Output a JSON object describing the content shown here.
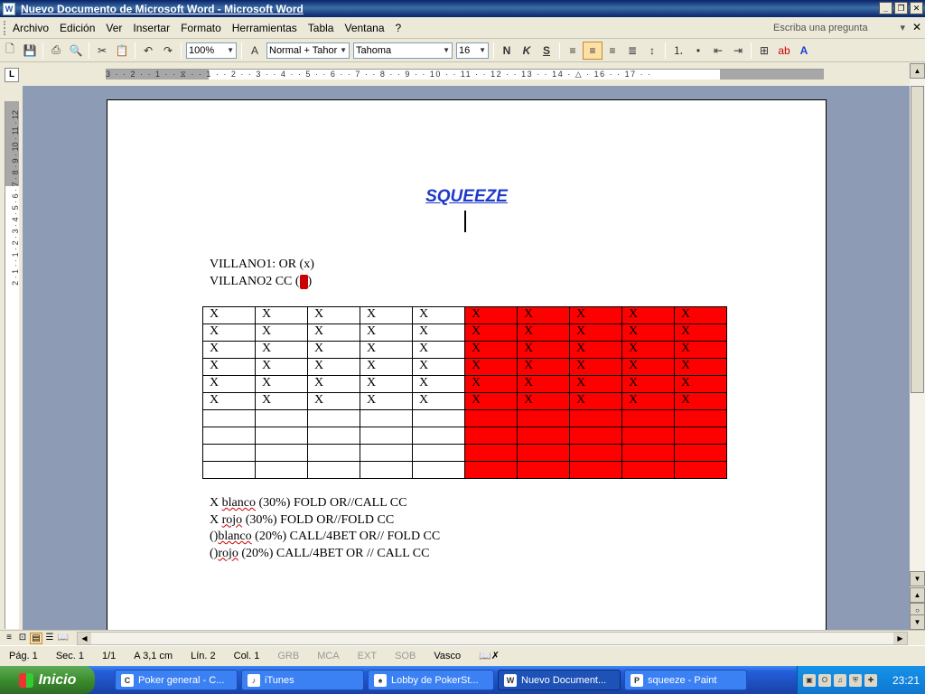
{
  "window": {
    "title": "Nuevo Documento de Microsoft Word - Microsoft Word",
    "app_icon": "W"
  },
  "menu": {
    "items": [
      "Archivo",
      "Edición",
      "Ver",
      "Insertar",
      "Formato",
      "Herramientas",
      "Tabla",
      "Ventana",
      "?"
    ],
    "help_placeholder": "Escriba una pregunta"
  },
  "toolbar": {
    "zoom": "100%",
    "style": "Normal + Tahor",
    "font": "Tahoma",
    "size": "16"
  },
  "ruler": {
    "scale": "3 · · 2 · · 1 · · ⧖ · · 1 · · 2 · · 3 · · 4 · · 5 · · 6 · · 7 · · 8 · · 9 · · 10 · · 11 · · 12 · · 13 · · 14 · △ · 16 · · 17 · ·",
    "vscale": "2 · 1 · · 1 · 2 · 3 · 4 · 5 · 6 · 7 · 8 · 9 · 10 · 11 · 12",
    "tab_selector": "L"
  },
  "document": {
    "heading": "SQUEEZE",
    "villano1": "VILLANO1: OR  (x)",
    "villano2": "VILLANO2 CC  (",
    "villano2_end": ")",
    "grid": {
      "rows": [
        [
          "X",
          "X",
          "X",
          "X",
          "X",
          "X",
          "X",
          "X",
          "X",
          "X"
        ],
        [
          "X",
          "X",
          "X",
          "X",
          "X",
          "X",
          "X",
          "X",
          "X",
          "X"
        ],
        [
          "X",
          "X",
          "X",
          "X",
          "X",
          "X",
          "X",
          "X",
          "X",
          "X"
        ],
        [
          "X",
          "X",
          "X",
          "X",
          "X",
          "X",
          "X",
          "X",
          "X",
          "X"
        ],
        [
          "X",
          "X",
          "X",
          "X",
          "X",
          "X",
          "X",
          "X",
          "X",
          "X"
        ],
        [
          "X",
          "X",
          "X",
          "X",
          "X",
          "X",
          "X",
          "X",
          "X",
          "X"
        ],
        [
          "",
          "",
          "",
          "",
          "",
          "",
          "",
          "",
          "",
          ""
        ],
        [
          "",
          "",
          "",
          "",
          "",
          "",
          "",
          "",
          "",
          ""
        ],
        [
          "",
          "",
          "",
          "",
          "",
          "",
          "",
          "",
          "",
          ""
        ],
        [
          "",
          "",
          "",
          "",
          "",
          "",
          "",
          "",
          "",
          ""
        ]
      ],
      "red_color": "#ff0000"
    },
    "legend": [
      {
        "prefix": "X ",
        "word": "blanco",
        "suffix": " (30%) FOLD OR//CALL CC"
      },
      {
        "prefix": "X ",
        "word": "rojo",
        "suffix": " (30%) FOLD OR//FOLD CC"
      },
      {
        "prefix": "()",
        "word": "blanco",
        "suffix": " (20%) CALL/4BET OR// FOLD CC"
      },
      {
        "prefix": "()",
        "word": "rojo",
        "suffix": " (20%) CALL/4BET OR // CALL CC"
      }
    ]
  },
  "status": {
    "page": "Pág. 1",
    "section": "Sec. 1",
    "pages": "1/1",
    "position": "A  3,1 cm",
    "line": "Lín. 2",
    "column": "Col. 1",
    "grb": "GRB",
    "mca": "MCA",
    "ext": "EXT",
    "sob": "SOB",
    "language": "Vasco"
  },
  "taskbar": {
    "start": "Inicio",
    "tasks": [
      {
        "label": "Poker general - C...",
        "icon": "C"
      },
      {
        "label": "iTunes",
        "icon": "♪"
      },
      {
        "label": "Lobby de PokerSt...",
        "icon": "♠"
      },
      {
        "label": "Nuevo Document...",
        "icon": "W"
      },
      {
        "label": "squeeze - Paint",
        "icon": "P"
      }
    ],
    "clock": "23:21"
  }
}
